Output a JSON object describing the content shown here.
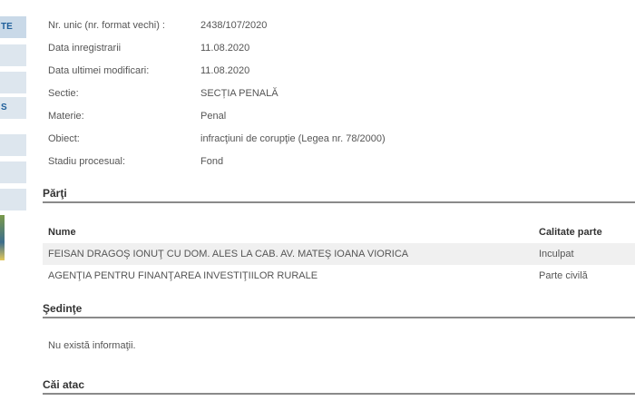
{
  "sidebar": {
    "tabs": [
      {
        "label": "TE"
      },
      {
        "label": ""
      },
      {
        "label": ""
      },
      {
        "label": "S"
      },
      {
        "label": ""
      },
      {
        "label": ""
      },
      {
        "label": ""
      },
      {
        "label": ""
      }
    ]
  },
  "details": [
    {
      "label": "Nr. unic (nr. format vechi) :",
      "value": "2438/107/2020"
    },
    {
      "label": "Data inregistrarii",
      "value": "11.08.2020"
    },
    {
      "label": "Data ultimei modificari:",
      "value": "11.08.2020"
    },
    {
      "label": "Sectie:",
      "value": "SECȚIA PENALĂ"
    },
    {
      "label": "Materie:",
      "value": "Penal"
    },
    {
      "label": "Obiect:",
      "value": "infracţiuni de corupţie (Legea nr. 78/2000)"
    },
    {
      "label": "Stadiu procesual:",
      "value": "Fond"
    }
  ],
  "parti": {
    "title": "Părţi",
    "columns": {
      "nume": "Nume",
      "calitate": "Calitate parte"
    },
    "rows": [
      {
        "nume": "FEISAN DRAGOŞ IONUŢ CU DOM. ALES LA CAB. AV. MATEŞ IOANA VIORICA",
        "calitate": "Inculpat"
      },
      {
        "nume": "AGENŢIA PENTRU FINANŢAREA INVESTIŢIILOR RURALE",
        "calitate": "Parte civilă"
      }
    ]
  },
  "sedinte": {
    "title": "Şedinţe",
    "empty_text": "Nu există informaţii."
  },
  "cai_atac": {
    "title": "Căi atac"
  }
}
